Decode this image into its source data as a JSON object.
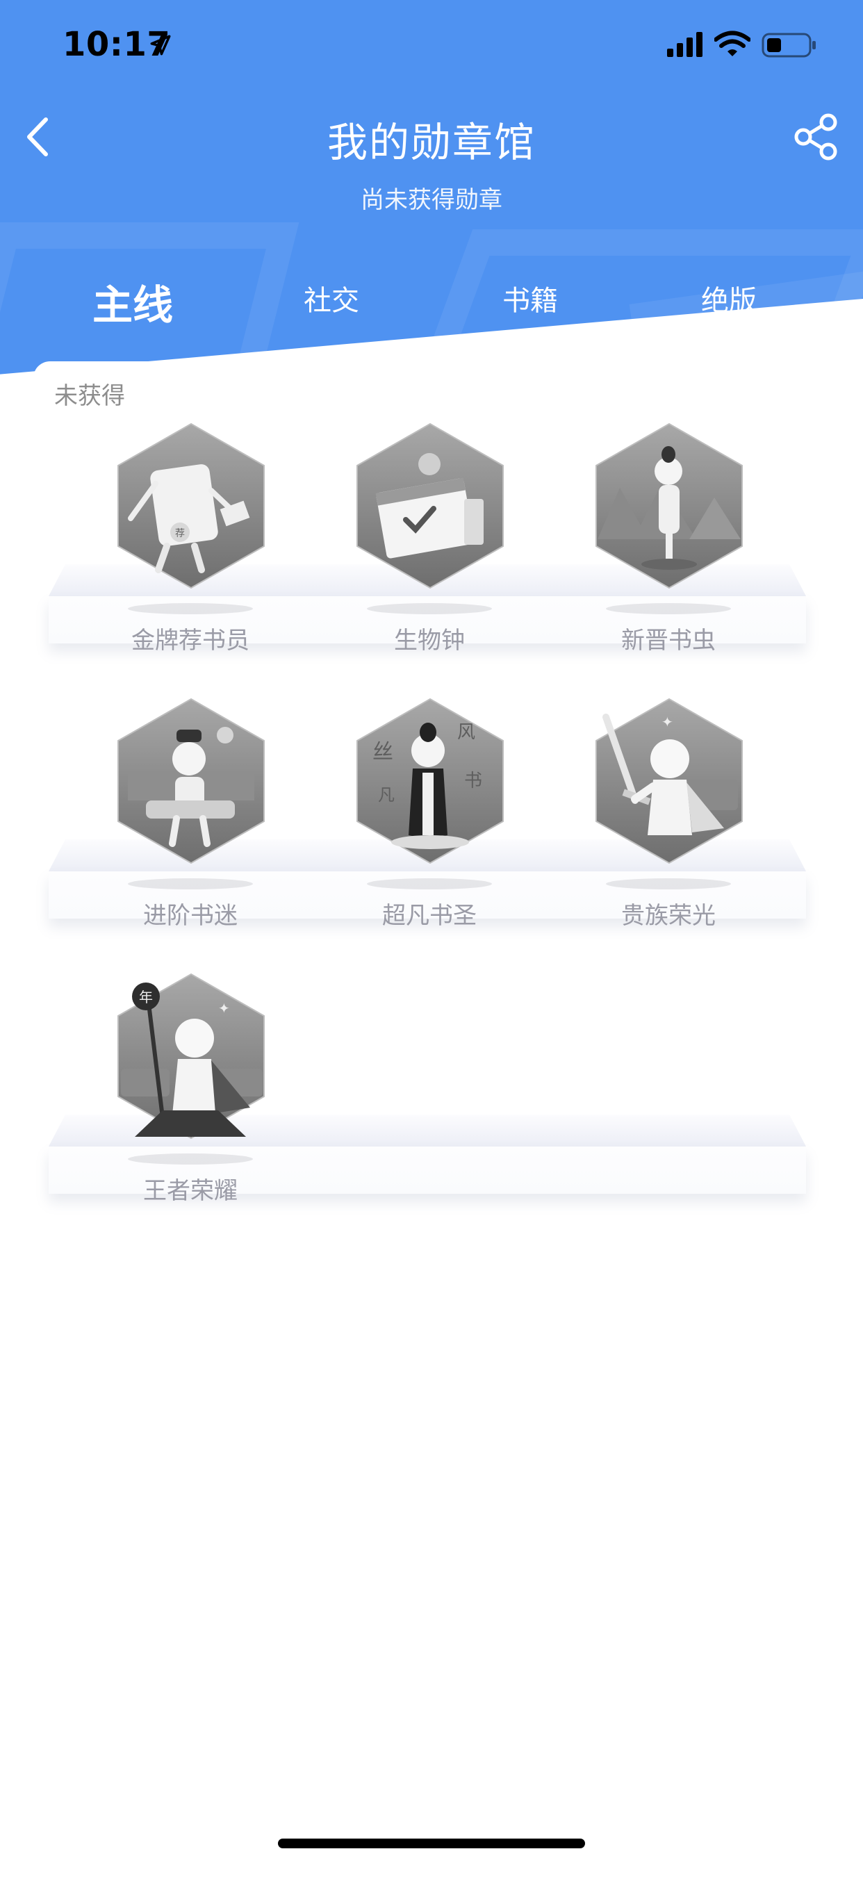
{
  "status_bar": {
    "time": "10:17"
  },
  "header": {
    "title": "我的勋章馆",
    "subtitle": "尚未获得勋章"
  },
  "tabs": [
    {
      "label": "主线",
      "active": true
    },
    {
      "label": "社交",
      "active": false
    },
    {
      "label": "书籍",
      "active": false
    },
    {
      "label": "绝版",
      "active": false
    }
  ],
  "section": {
    "label": "未获得"
  },
  "medals": [
    {
      "name": "金牌荐书员",
      "icon": "recommender-badge-icon"
    },
    {
      "name": "生物钟",
      "icon": "calendar-clock-badge-icon"
    },
    {
      "name": "新晋书虫",
      "icon": "scholar-landscape-badge-icon"
    },
    {
      "name": "进阶书迷",
      "icon": "scholar-scroll-badge-icon"
    },
    {
      "name": "超凡书圣",
      "icon": "calligraphy-master-badge-icon"
    },
    {
      "name": "贵族荣光",
      "icon": "knight-sword-badge-icon"
    },
    {
      "name": "王者荣耀",
      "icon": "king-scepter-badge-icon"
    }
  ],
  "colors": {
    "header": "#4f92f1",
    "medal_text": "#9a9ba6",
    "label_text": "#8d8d8d"
  }
}
